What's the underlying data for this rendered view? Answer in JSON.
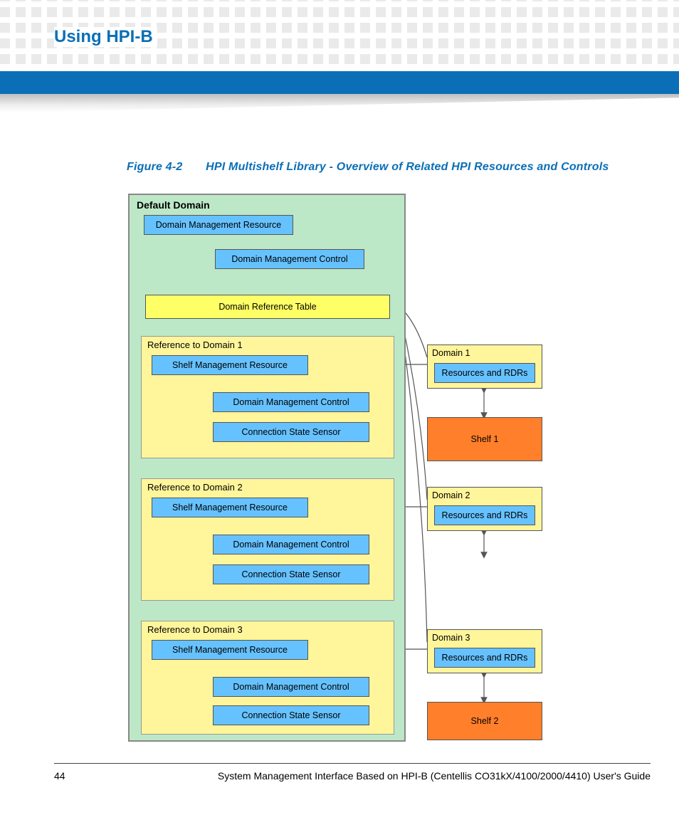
{
  "header": {
    "title": "Using HPI-B"
  },
  "figure": {
    "label": "Figure 4-2",
    "caption": "HPI Multishelf Library - Overview of Related HPI Resources and Controls"
  },
  "diagram": {
    "default_domain_title": "Default Domain",
    "domain_mgmt_resource": "Domain Management Resource",
    "domain_mgmt_control": "Domain Management Control",
    "domain_ref_table": "Domain Reference Table",
    "references": [
      {
        "title": "Reference to Domain 1",
        "smr": "Shelf Management Resource",
        "dmc": "Domain Management Control",
        "css": "Connection State Sensor",
        "domain_title": "Domain 1",
        "domain_content": "Resources and RDRs",
        "shelf": "Shelf 1"
      },
      {
        "title": "Reference to Domain 2",
        "smr": "Shelf Management Resource",
        "dmc": "Domain Management Control",
        "css": "Connection State Sensor",
        "domain_title": "Domain 2",
        "domain_content": "Resources and RDRs",
        "shelf": ""
      },
      {
        "title": "Reference to Domain 3",
        "smr": "Shelf Management Resource",
        "dmc": "Domain Management Control",
        "css": "Connection State Sensor",
        "domain_title": "Domain 3",
        "domain_content": "Resources and RDRs",
        "shelf": "Shelf 2"
      }
    ]
  },
  "footer": {
    "page": "44",
    "text": "System Management Interface Based on HPI-B (Centellis CO31kX/4100/2000/4410) User's Guide"
  }
}
